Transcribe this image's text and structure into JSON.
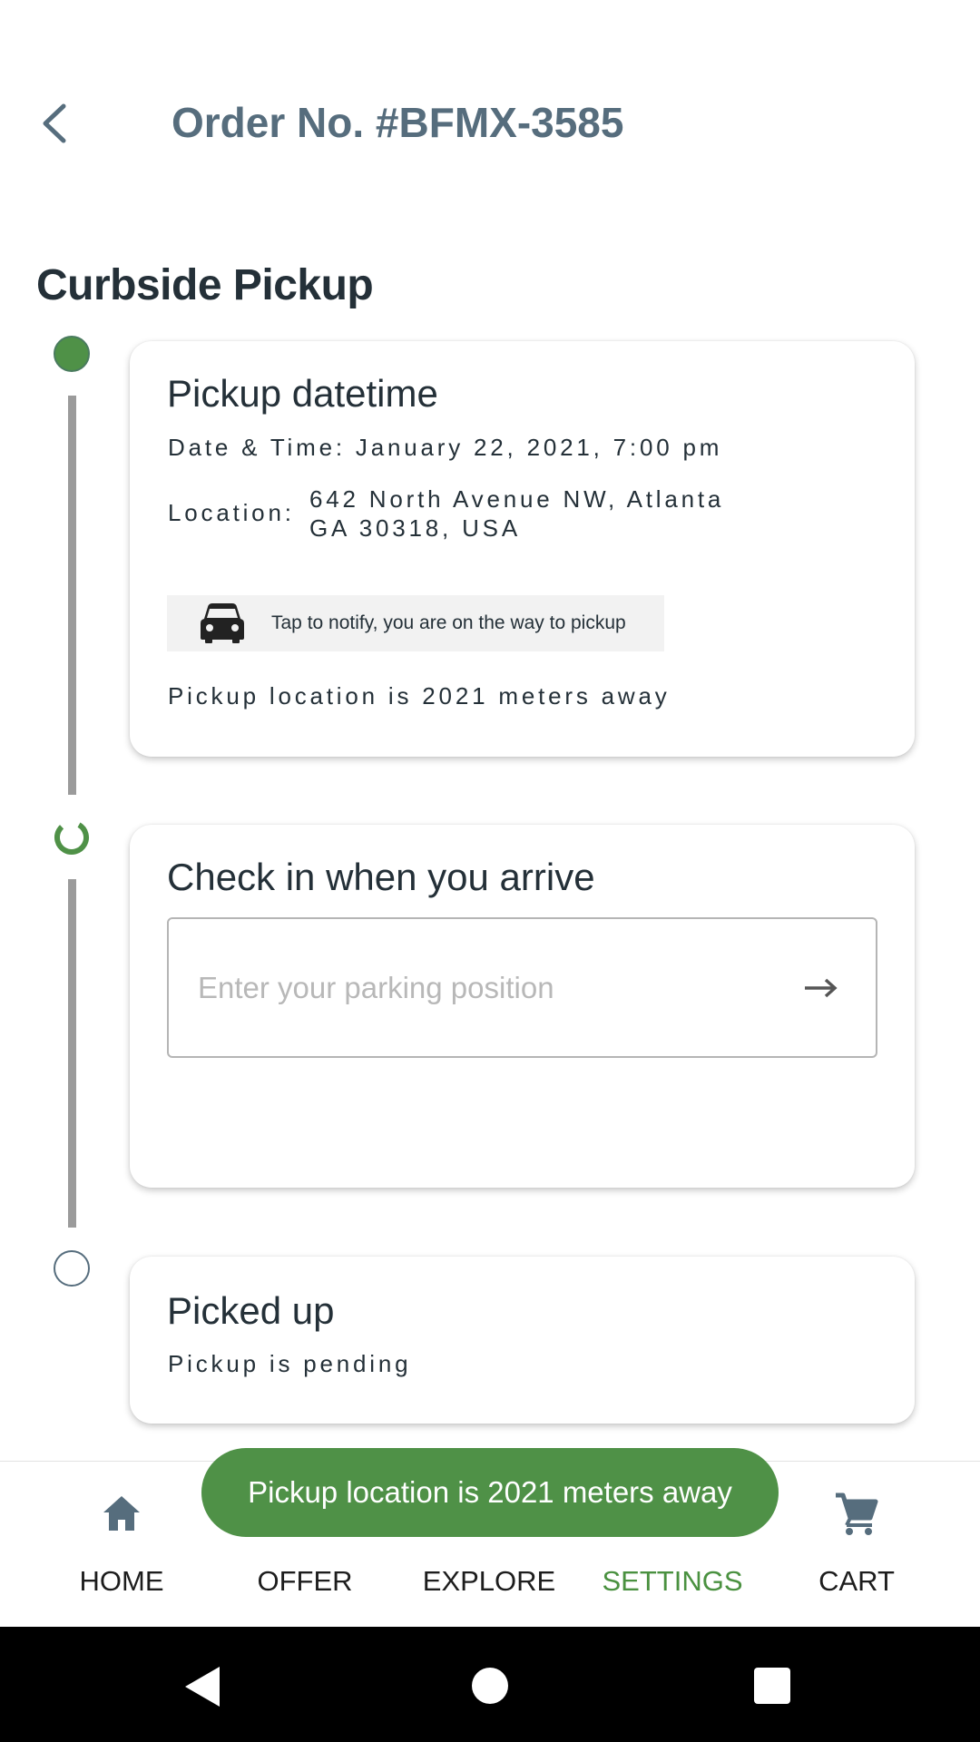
{
  "header": {
    "title": "Order No. #BFMX-3585",
    "back_icon": "chevron-left-icon"
  },
  "section_title": "Curbside Pickup",
  "steps": [
    {
      "status": "done",
      "title": "Pickup datetime",
      "datetime_text": "Date & Time: January 22, 2021, 7:00 pm",
      "location_label": "Location:",
      "location_line1": "642 North Avenue NW, Atlanta",
      "location_line2": "GA 30318, USA",
      "notify_icon": "car-icon",
      "notify_label": "Tap to notify, you are on the way to pickup",
      "distance_text": "Pickup location is 2021 meters away"
    },
    {
      "status": "in-progress",
      "title": "Check in when you arrive",
      "input_placeholder": "Enter your parking position",
      "input_value": "",
      "submit_icon": "arrow-right-icon"
    },
    {
      "status": "pending",
      "title": "Picked up",
      "status_text": "Pickup is pending"
    }
  ],
  "bottom_nav": [
    {
      "label": "HOME",
      "icon": "home-icon",
      "active": false
    },
    {
      "label": "OFFER",
      "icon": "offer-icon",
      "active": false
    },
    {
      "label": "EXPLORE",
      "icon": "explore-icon",
      "active": false
    },
    {
      "label": "SETTINGS",
      "icon": "settings-icon",
      "active": true
    },
    {
      "label": "CART",
      "icon": "cart-icon",
      "active": false
    }
  ],
  "toast": "Pickup location is 2021 meters away",
  "colors": {
    "accent_green": "#4f9147",
    "header_text": "#566d7d",
    "body_text": "#243038",
    "active_nav": "#4a9140"
  }
}
